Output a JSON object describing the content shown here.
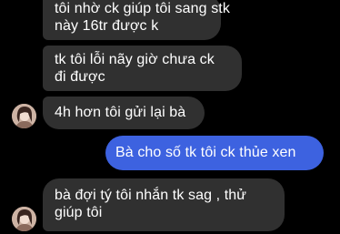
{
  "conversation": {
    "messages": [
      {
        "sender": "contact",
        "lines": [
          "tôi nhờ ck giúp tôi sang stk",
          "này 16tr được k"
        ]
      },
      {
        "sender": "contact",
        "lines": [
          "tk tôi lỗi nãy giờ chưa ck",
          "đi được"
        ]
      },
      {
        "sender": "contact",
        "lines": [
          "4h hơn tôi gửi lại bà"
        ]
      },
      {
        "sender": "me",
        "lines": [
          "Bà cho số tk tôi ck thủe xen"
        ]
      },
      {
        "sender": "contact",
        "lines": [
          "bà đợi tý tôi nhắn tk sag , thử",
          "giúp tôi"
        ]
      }
    ]
  },
  "colors": {
    "background": "#000000",
    "incoming_bubble": "#303030",
    "outgoing_bubble": "#3d62e0",
    "text": "#ffffff"
  }
}
